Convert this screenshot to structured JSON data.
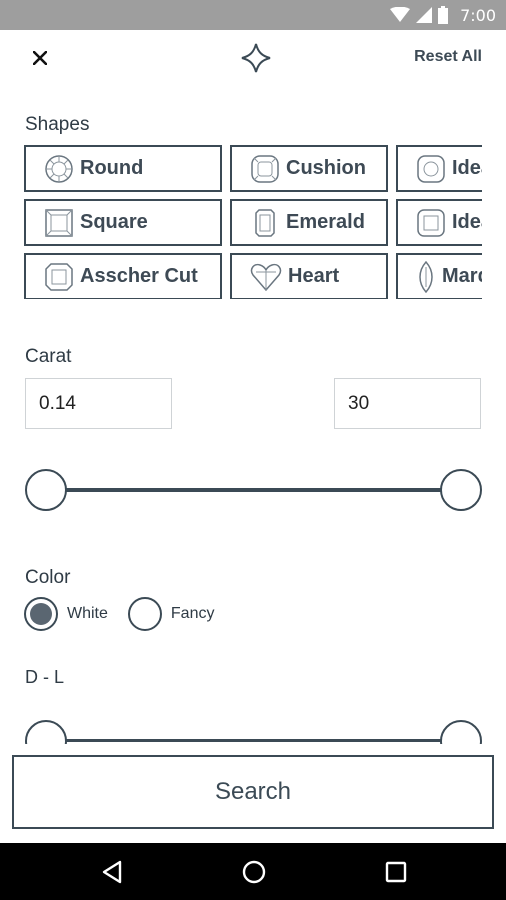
{
  "status_bar": {
    "time": "7:00"
  },
  "header": {
    "reset_label": "Reset All"
  },
  "shapes": {
    "label": "Shapes",
    "items": [
      {
        "label": "Round",
        "icon": "round-diamond-icon"
      },
      {
        "label": "Cushion",
        "icon": "cushion-diamond-icon"
      },
      {
        "label": "Ideal",
        "icon": "ideal-diamond-icon"
      },
      {
        "label": "Square",
        "icon": "square-diamond-icon"
      },
      {
        "label": "Emerald",
        "icon": "emerald-diamond-icon"
      },
      {
        "label": "Ideal",
        "icon": "ideal-square-diamond-icon"
      },
      {
        "label": "Asscher Cut",
        "icon": "asscher-diamond-icon"
      },
      {
        "label": "Heart",
        "icon": "heart-diamond-icon"
      },
      {
        "label": "Marquise",
        "icon": "marquise-diamond-icon"
      }
    ]
  },
  "carat": {
    "label": "Carat",
    "min_value": "0.14",
    "max_value": "30"
  },
  "color": {
    "label": "Color",
    "options": [
      {
        "label": "White",
        "selected": true
      },
      {
        "label": "Fancy",
        "selected": false
      }
    ],
    "range_label": "D - L"
  },
  "search": {
    "label": "Search"
  },
  "colors": {
    "accent": "#3b4a55",
    "status_bar": "#9e9e9e",
    "nav_bar": "#000000"
  }
}
